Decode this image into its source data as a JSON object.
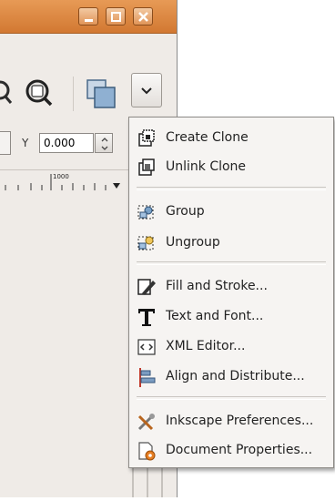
{
  "window": {
    "titlebar_buttons": [
      "minimize-icon",
      "maximize-icon",
      "close-icon"
    ]
  },
  "toolbar": {
    "icons": [
      "zoom-drawing-icon",
      "zoom-page-icon",
      "duplicate-icon",
      "chevron-down-icon"
    ]
  },
  "coords": {
    "y_label": "Y",
    "y_value": "0.000"
  },
  "ruler": {
    "label": "1000"
  },
  "menu": {
    "items": [
      {
        "label": "Create Clone",
        "icon": "create-clone-icon"
      },
      {
        "label": "Unlink Clone",
        "icon": "unlink-clone-icon"
      },
      {
        "label": "Group",
        "icon": "group-icon"
      },
      {
        "label": "Ungroup",
        "icon": "ungroup-icon"
      },
      {
        "label": "Fill and Stroke...",
        "icon": "fill-stroke-icon"
      },
      {
        "label": "Text and Font...",
        "icon": "text-font-icon"
      },
      {
        "label": "XML Editor...",
        "icon": "xml-editor-icon"
      },
      {
        "label": "Align and Distribute...",
        "icon": "align-distribute-icon"
      },
      {
        "label": "Inkscape Preferences...",
        "icon": "preferences-icon"
      },
      {
        "label": "Document Properties...",
        "icon": "document-properties-icon"
      }
    ]
  },
  "colors": {
    "titlebar": "#d27832",
    "menu_bg": "#f6f4f2",
    "window_bg": "#efebe7"
  }
}
